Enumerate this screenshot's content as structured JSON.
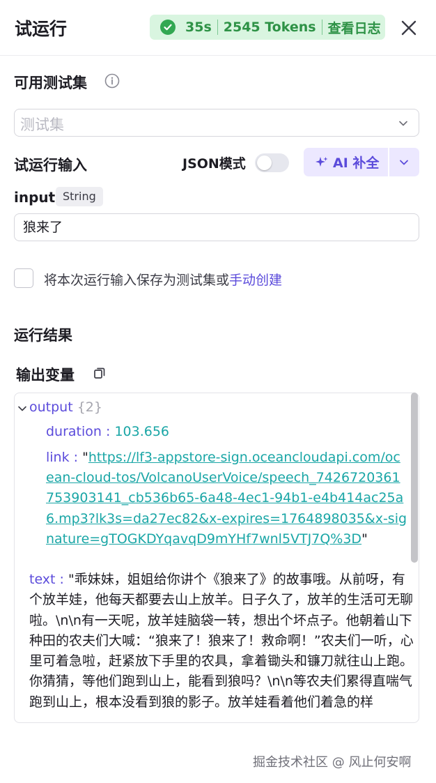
{
  "header": {
    "title": "试运行",
    "duration": "35s",
    "tokens": "2545 Tokens",
    "view_log": "查看日志"
  },
  "test_set": {
    "label": "可用测试集",
    "placeholder": "测试集"
  },
  "run_input": {
    "label": "试运行输入",
    "json_mode_label": "JSON模式",
    "json_mode_on": false,
    "ai_button_label": "AI 补全"
  },
  "input_field": {
    "name": "input",
    "type": "String",
    "value": "狼来了"
  },
  "save_option": {
    "text": "将本次运行输入保存为测试集或",
    "link": "手动创建"
  },
  "results": {
    "label": "运行结果",
    "output_vars_label": "输出变量"
  },
  "output": {
    "key": "output",
    "count": "{2}",
    "duration_key": "duration",
    "duration_value": "103.656",
    "link_key": "link",
    "link_value": "https://lf3-appstore-sign.oceancloudapi.com/ocean-cloud-tos/VolcanoUserVoice/speech_7426720361753903141_cb536b65-6a48-4ec1-94b1-e4b414ac25a6.mp3?lk3s=da27ec82&x-expires=1764898035&x-signature=gTOGKDYqavqD9mYHf7wnl5VTJ7Q%3D",
    "text_key": "text",
    "text_value": "乖妹妹，姐姐给你讲个《狼来了》的故事哦。从前呀，有个放羊娃，他每天都要去山上放羊。日子久了，放羊的生活可无聊啦。\\n\\n有一天呢，放羊娃脑袋一转，想出个坏点子。他朝着山下种田的农夫们大喊：“狼来了！狼来了！救命啊！”农夫们一听，心里可着急啦，赶紧放下手里的农具，拿着锄头和镰刀就往山上跑。你猜猜，等他们跑到山上，能看到狼吗？\\n\\n等农夫们累得直喘气跑到山上，根本没看到狼的影子。放羊娃看着他们着急的样"
  },
  "watermark": "掘金技术社区 @ 风止何安啊",
  "colors": {
    "accent": "#5b4bdb",
    "success": "#2e9246",
    "success_bg": "#d9f5e0",
    "number": "#1aa6a6"
  },
  "icons": [
    "check-circle-icon",
    "close-icon",
    "info-icon",
    "chevron-down-icon",
    "sparkle-icon",
    "copy-icon",
    "caret-down-icon"
  ]
}
